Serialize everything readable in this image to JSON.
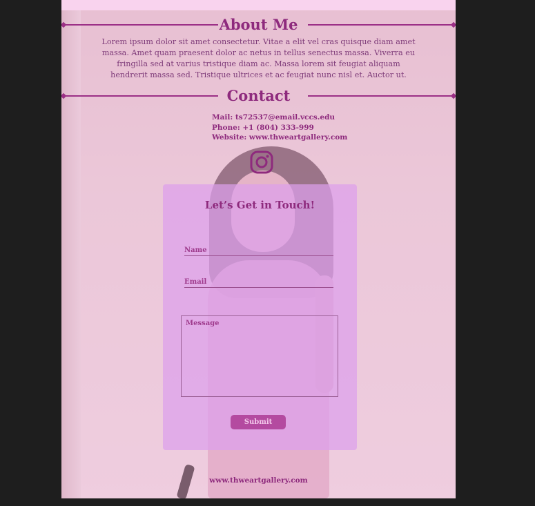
{
  "about": {
    "title": "About Me",
    "text": "Lorem ipsum dolor sit amet consectetur. Vitae a elit vel cras quisque diam amet massa. Amet quam praesent dolor ac netus in tellus senectus massa. Viverra eu fringilla sed at varius tristique diam ac. Massa lorem sit feugiat aliquam hendrerit massa sed. Tristique ultrices et ac feugiat nunc nisl et. Auctor ut."
  },
  "contact": {
    "title": "Contact",
    "mail": "Mail: ts72537@email.vccs.edu",
    "phone": "Phone: +1 (804) 333-999",
    "website": "Website: www.thweartgallery.com",
    "social_icon": "instagram-icon"
  },
  "form": {
    "title": "Let’s Get in Touch!",
    "name_placeholder": "Name",
    "email_placeholder": "Email",
    "message_placeholder": "Message",
    "submit_label": "Submit"
  },
  "footer": {
    "link": "www.thweartgallery.com"
  },
  "colors": {
    "accent": "#8e2a7d",
    "form_bg": "#dca0ec",
    "button": "#b44aa0",
    "page_bg": "#1e1e1e"
  }
}
